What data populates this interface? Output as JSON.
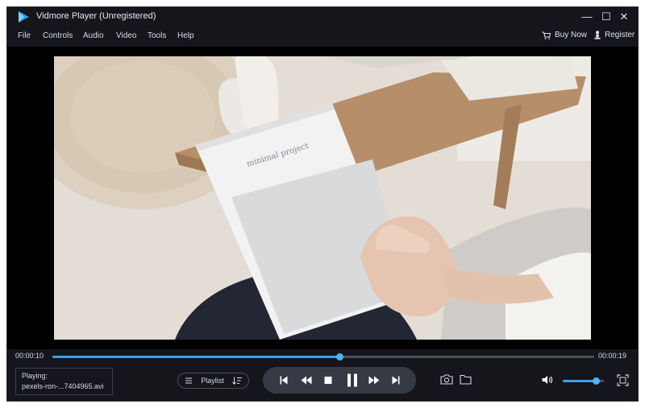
{
  "window": {
    "title": "Vidmore Player (Unregistered)",
    "controls": [
      "minimize-icon",
      "maximize-icon",
      "close-icon"
    ],
    "minimize_glyph": "—",
    "maximize_glyph": "☐",
    "close_glyph": "✕"
  },
  "menu": {
    "items": [
      "File",
      "Controls",
      "Audio",
      "Video",
      "Tools",
      "Help"
    ],
    "buy_now": "Buy Now",
    "register": "Register"
  },
  "playback": {
    "current_time": "00:00:10",
    "total_time": "00:00:19",
    "progress": 0.53,
    "volume": 0.8
  },
  "now_playing": {
    "label": "Playing:",
    "file": "pexels-ron-...7404965.avi"
  },
  "playlist": {
    "label": "Playlist"
  },
  "colors": {
    "background": "#14161c",
    "accent": "#3aa0e8",
    "controls_pill": "#363a44"
  },
  "icons": [
    "app-logo-icon",
    "cart-icon",
    "register-icon",
    "list-icon",
    "sort-icon",
    "skip-previous-icon",
    "rewind-icon",
    "stop-icon",
    "pause-icon",
    "fast-forward-icon",
    "skip-next-icon",
    "camera-icon",
    "folder-icon",
    "volume-icon",
    "fullscreen-icon"
  ]
}
